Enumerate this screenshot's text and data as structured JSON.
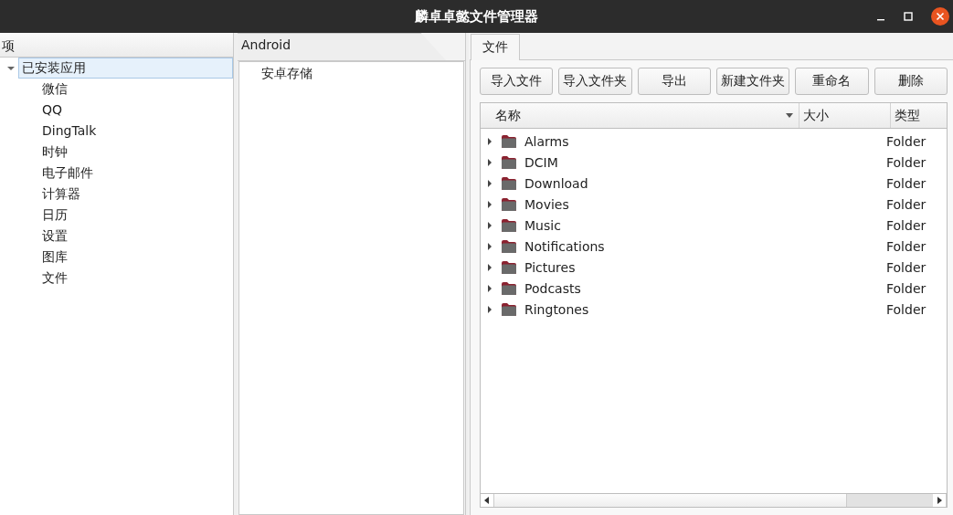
{
  "window": {
    "title": "麟卓卓懿文件管理器"
  },
  "tree": {
    "header": "项",
    "items": [
      {
        "label": "已安装应用",
        "selected": true,
        "expanded": true,
        "children": [
          {
            "label": "微信",
            "selected": false
          },
          {
            "label": "QQ",
            "selected": false
          },
          {
            "label": "DingTalk",
            "selected": false
          },
          {
            "label": "时钟",
            "selected": false
          },
          {
            "label": "电子邮件",
            "selected": false
          },
          {
            "label": "计算器",
            "selected": false
          },
          {
            "label": "日历",
            "selected": false
          },
          {
            "label": "设置",
            "selected": false
          },
          {
            "label": "图库",
            "selected": false
          },
          {
            "label": "文件",
            "selected": false
          }
        ]
      }
    ]
  },
  "storage_panel": {
    "tabs": [
      {
        "label": "Android",
        "selected": true
      }
    ],
    "items": [
      {
        "label": "安卓存储"
      }
    ]
  },
  "file_panel": {
    "tabs": [
      {
        "label": "文件",
        "selected": true
      }
    ],
    "buttons": [
      "导入文件",
      "导入文件夹",
      "导出",
      "新建文件夹",
      "重命名",
      "删除"
    ],
    "table": {
      "columns": [
        {
          "label": "名称",
          "sorted": true
        },
        {
          "label": "大小",
          "sorted": false
        },
        {
          "label": "类型",
          "sorted": false
        }
      ],
      "rows": [
        {
          "name": "Alarms",
          "type": "Folder",
          "expanded": false
        },
        {
          "name": "DCIM",
          "type": "Folder",
          "expanded": false
        },
        {
          "name": "Download",
          "type": "Folder",
          "expanded": false
        },
        {
          "name": "Movies",
          "type": "Folder",
          "expanded": false
        },
        {
          "name": "Music",
          "type": "Folder",
          "expanded": false
        },
        {
          "name": "Notifications",
          "type": "Folder",
          "expanded": false
        },
        {
          "name": "Pictures",
          "type": "Folder",
          "expanded": false
        },
        {
          "name": "Podcasts",
          "type": "Folder",
          "expanded": false
        },
        {
          "name": "Ringtones",
          "type": "Folder",
          "expanded": false
        }
      ]
    }
  }
}
